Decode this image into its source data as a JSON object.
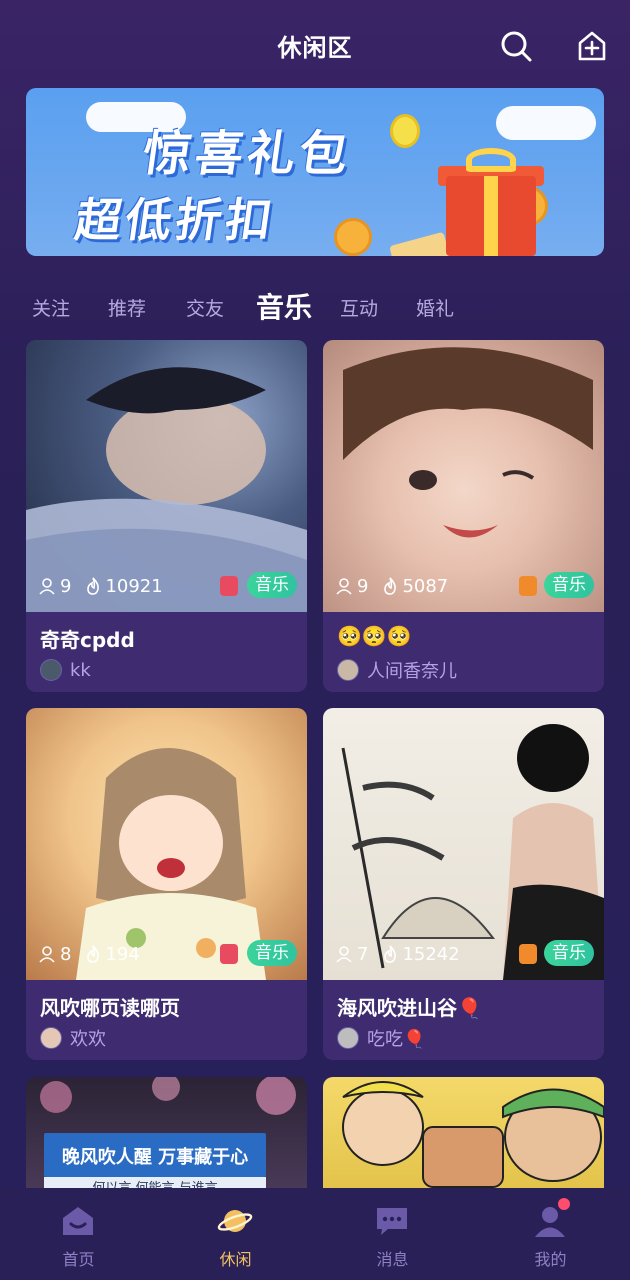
{
  "header": {
    "title": "休闲区",
    "search_icon": "search-icon",
    "add_icon": "add-room-icon"
  },
  "banner": {
    "line1": "惊喜礼包",
    "line2": "超低折扣"
  },
  "tabs": [
    {
      "label": "关注",
      "active": false
    },
    {
      "label": "推荐",
      "active": false
    },
    {
      "label": "交友",
      "active": false
    },
    {
      "label": "音乐",
      "active": true
    },
    {
      "label": "互动",
      "active": false
    },
    {
      "label": "婚礼",
      "active": false
    }
  ],
  "cards": [
    {
      "users": "9",
      "heat": "10921",
      "tag": "音乐",
      "title": "奇奇cpdd",
      "owner": "kk",
      "badge_color": "#e84a5f"
    },
    {
      "users": "9",
      "heat": "5087",
      "tag": "音乐",
      "title": "🥺🥺🥺",
      "owner": "人间香奈儿",
      "badge_color": "#f08a2a"
    },
    {
      "users": "8",
      "heat": "194",
      "tag": "音乐",
      "title": "风吹哪页读哪页",
      "owner": "欢欢",
      "badge_color": "#e84a5f"
    },
    {
      "users": "7",
      "heat": "15242",
      "tag": "音乐",
      "title": "海风吹进山谷🎈",
      "owner": "吃吃🎈",
      "badge_color": "#f08a2a"
    }
  ],
  "partial_cards": [
    {
      "text": "晚风吹人醒 万事藏于心",
      "subtext": "何以言 何能言 与谁言"
    },
    {
      "text": ""
    }
  ],
  "nav": [
    {
      "label": "首页",
      "icon": "home-icon",
      "active": false
    },
    {
      "label": "休闲",
      "icon": "planet-icon",
      "active": true
    },
    {
      "label": "消息",
      "icon": "message-icon",
      "active": false
    },
    {
      "label": "我的",
      "icon": "profile-icon",
      "active": false
    }
  ],
  "colors": {
    "accent": "#f2c063",
    "tag": "#3bd49a",
    "background": "#2a1f55"
  }
}
